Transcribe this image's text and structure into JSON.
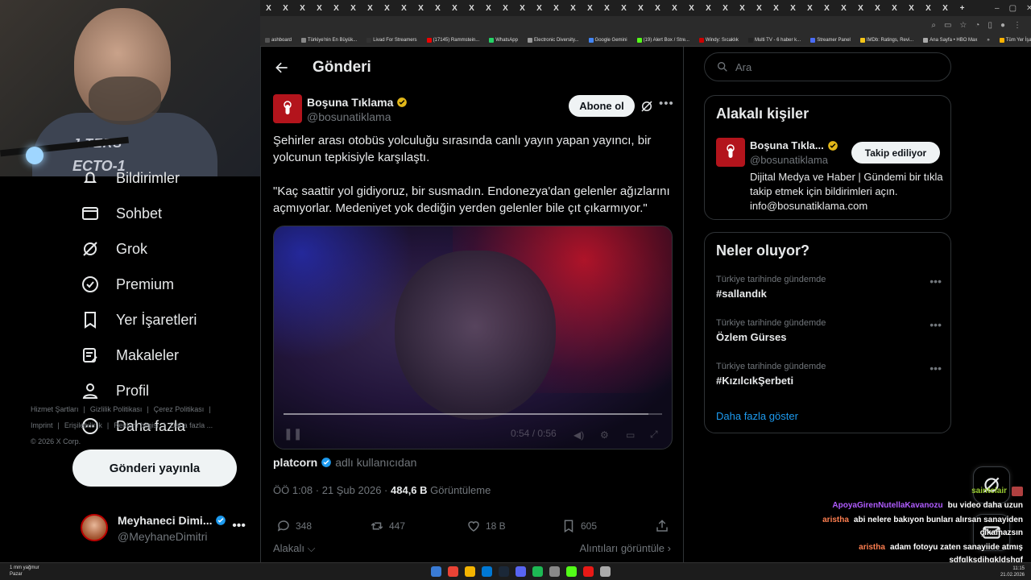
{
  "browser": {
    "tab_glyph": "X",
    "tab_count": 41,
    "new_tab": "+",
    "window_controls": [
      "–",
      "▢",
      "✕"
    ],
    "bookmarks": [
      {
        "label": "ashboard",
        "color": "#555"
      },
      {
        "label": "Türkiye'nin En Büyük...",
        "color": "#888"
      },
      {
        "label": "Livad For Streamers",
        "color": "#333"
      },
      {
        "label": "(17145) Rammstein...",
        "color": "#e00"
      },
      {
        "label": "WhatsApp",
        "color": "#25d366"
      },
      {
        "label": "Electronic Diversity...",
        "color": "#999"
      },
      {
        "label": "Google Gemini",
        "color": "#4285f4"
      },
      {
        "label": "(19) Alert Box / Stre...",
        "color": "#53fc18"
      },
      {
        "label": "Windy: Sıcaklık",
        "color": "#c00"
      },
      {
        "label": "Multi TV - 6 haber k...",
        "color": "#222"
      },
      {
        "label": "Streamer Panel",
        "color": "#4a6cf7"
      },
      {
        "label": "IMDb: Ratings, Revi...",
        "color": "#f5c518"
      },
      {
        "label": "Ana Sayfa • HBO Max",
        "color": "#aaa"
      },
      {
        "label": "»",
        "color": ""
      },
      {
        "label": "Tüm Yer İşaretleri",
        "color": "#ffb300"
      }
    ]
  },
  "webcam": {
    "shirt_line1": "J  TERS",
    "shirt_line2": "ECTO-1"
  },
  "nav": {
    "items": [
      {
        "label": "Bildirimler",
        "icon": "bell-icon"
      },
      {
        "label": "Sohbet",
        "icon": "mail-icon"
      },
      {
        "label": "Grok",
        "icon": "grok-icon"
      },
      {
        "label": "Premium",
        "icon": "verified-icon"
      },
      {
        "label": "Yer İşaretleri",
        "icon": "bookmark-icon"
      },
      {
        "label": "Makaleler",
        "icon": "article-icon"
      },
      {
        "label": "Profil",
        "icon": "profile-icon"
      },
      {
        "label": "Daha fazla",
        "icon": "more-circle-icon"
      }
    ],
    "post_button": "Gönderi yayınla",
    "account": {
      "name": "Meyhaneci Dimi...",
      "handle": "@MeyhaneDimitri",
      "more": "•••"
    }
  },
  "post": {
    "header_title": "Gönderi",
    "author": {
      "name": "Boşuna Tıklama",
      "handle": "@bosunatiklama"
    },
    "subscribe_label": "Abone ol",
    "more": "•••",
    "text1": "Şehirler arası otobüs yolculuğu sırasında canlı yayın yapan yayıncı, bir yolcunun tepkisiyle karşılaştı.",
    "text2": "\"Kaç saattir yol gidiyoruz, bir susmadın. Endonezya'dan gelenler ağızlarını açmıyorlar. Medeniyet yok dediğin yerden gelenler bile çıt çıkarmıyor.\"",
    "video": {
      "time": "0:54 / 0:56",
      "progress": 0.964
    },
    "via_user": "platcorn",
    "via_suffix": "adlı kullanıcıdan",
    "time": "ÖÖ 1:08 · 21 Şub 2026 ·",
    "views": "484,6 B",
    "views_label": "Görüntüleme",
    "stats": {
      "replies": "348",
      "reposts": "447",
      "likes": "18 B",
      "bookmarks": "605"
    },
    "related_left": "Alakalı",
    "related_right": "Alıntıları görüntüle"
  },
  "sidebar": {
    "search_placeholder": "Ara",
    "related_title": "Alakalı kişiler",
    "related": {
      "name": "Boşuna Tıkla...",
      "handle": "@bosunatiklama",
      "follow_label": "Takip ediliyor",
      "bio": "Dijital Medya ve Haber | Gündemi bir tıkla takip etmek için bildirimleri açın. info@bosunatiklama.com"
    },
    "trends_title": "Neler oluyor?",
    "trends": [
      {
        "context": "Türkiye tarihinde gündemde",
        "name": "#sallandık"
      },
      {
        "context": "Türkiye tarihinde gündemde",
        "name": "Özlem Gürses"
      },
      {
        "context": "Türkiye tarihinde gündemde",
        "name": "#KızılcıkŞerbeti"
      }
    ],
    "show_more": "Daha fazla göster",
    "footer_line1": [
      "Hizmet Şartları",
      "|",
      "Gizlilik Politikası",
      "|",
      "Çerez Politikası",
      "|"
    ],
    "footer_line2": [
      "Imprint",
      "|",
      "Erişilebilirlik",
      "|",
      "Reklam bilgisi",
      "|",
      "Daha fazla ..."
    ],
    "footer_line3": "© 2026 X Corp."
  },
  "chat": [
    {
      "user": "saintclair",
      "color": "#9acd32",
      "msg": ""
    },
    {
      "user": "ApoyaGirenNutellaKavanozu",
      "color": "#b05cff",
      "msg": "bu video daha uzun"
    },
    {
      "user": "aristha",
      "color": "#ff7f50",
      "msg": "abi nelere bakıyon bunları alırsan sanayiden"
    },
    {
      "user": "",
      "color": "#ff7f50",
      "msg": "çıkamazsın"
    },
    {
      "user": "aristha",
      "color": "#ff7f50",
      "msg": "adam fotoyu zaten sanayiide atmış"
    },
    {
      "user": "",
      "color": "#ffffff",
      "msg": "sdfglksdjhgkldshgf"
    }
  ],
  "taskbar": {
    "weather_line1": "1 mm yağmur",
    "weather_line2": "Pazar",
    "clock_time": "11:15",
    "clock_date": "21.02.2026",
    "icons": [
      "#3a7bd5",
      "#ea4335",
      "#f4b400",
      "#0078d4",
      "#1b2838",
      "#5865f2",
      "#1db954",
      "#888",
      "#53fc18",
      "#e91916",
      "#aaa"
    ]
  }
}
